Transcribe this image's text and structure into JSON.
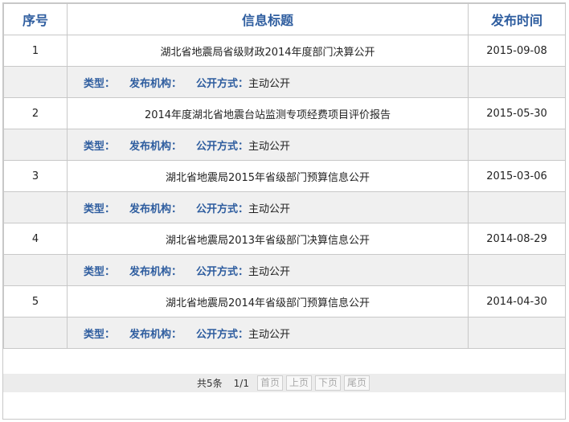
{
  "header": {
    "col_index": "序号",
    "col_title": "信息标题",
    "col_date": "发布时间"
  },
  "labels": {
    "type": "类型：",
    "org": "发布机构：",
    "method": "公开方式：",
    "method_value": "主动公开"
  },
  "rows": [
    {
      "index": "1",
      "title": "湖北省地震局省级财政2014年度部门决算公开",
      "date": "2015-09-08"
    },
    {
      "index": "2",
      "title": "2014年度湖北省地震台站监测专项经费项目评价报告",
      "date": "2015-05-30"
    },
    {
      "index": "3",
      "title": "湖北省地震局2015年省级部门预算信息公开",
      "date": "2015-03-06"
    },
    {
      "index": "4",
      "title": "湖北省地震局2013年省级部门决算信息公开",
      "date": "2014-08-29"
    },
    {
      "index": "5",
      "title": "湖北省地震局2014年省级部门预算信息公开",
      "date": "2014-04-30"
    }
  ],
  "pager": {
    "total": "共5条",
    "pages": "1/1",
    "first": "首页",
    "prev": "上页",
    "next": "下页",
    "last": "尾页"
  }
}
